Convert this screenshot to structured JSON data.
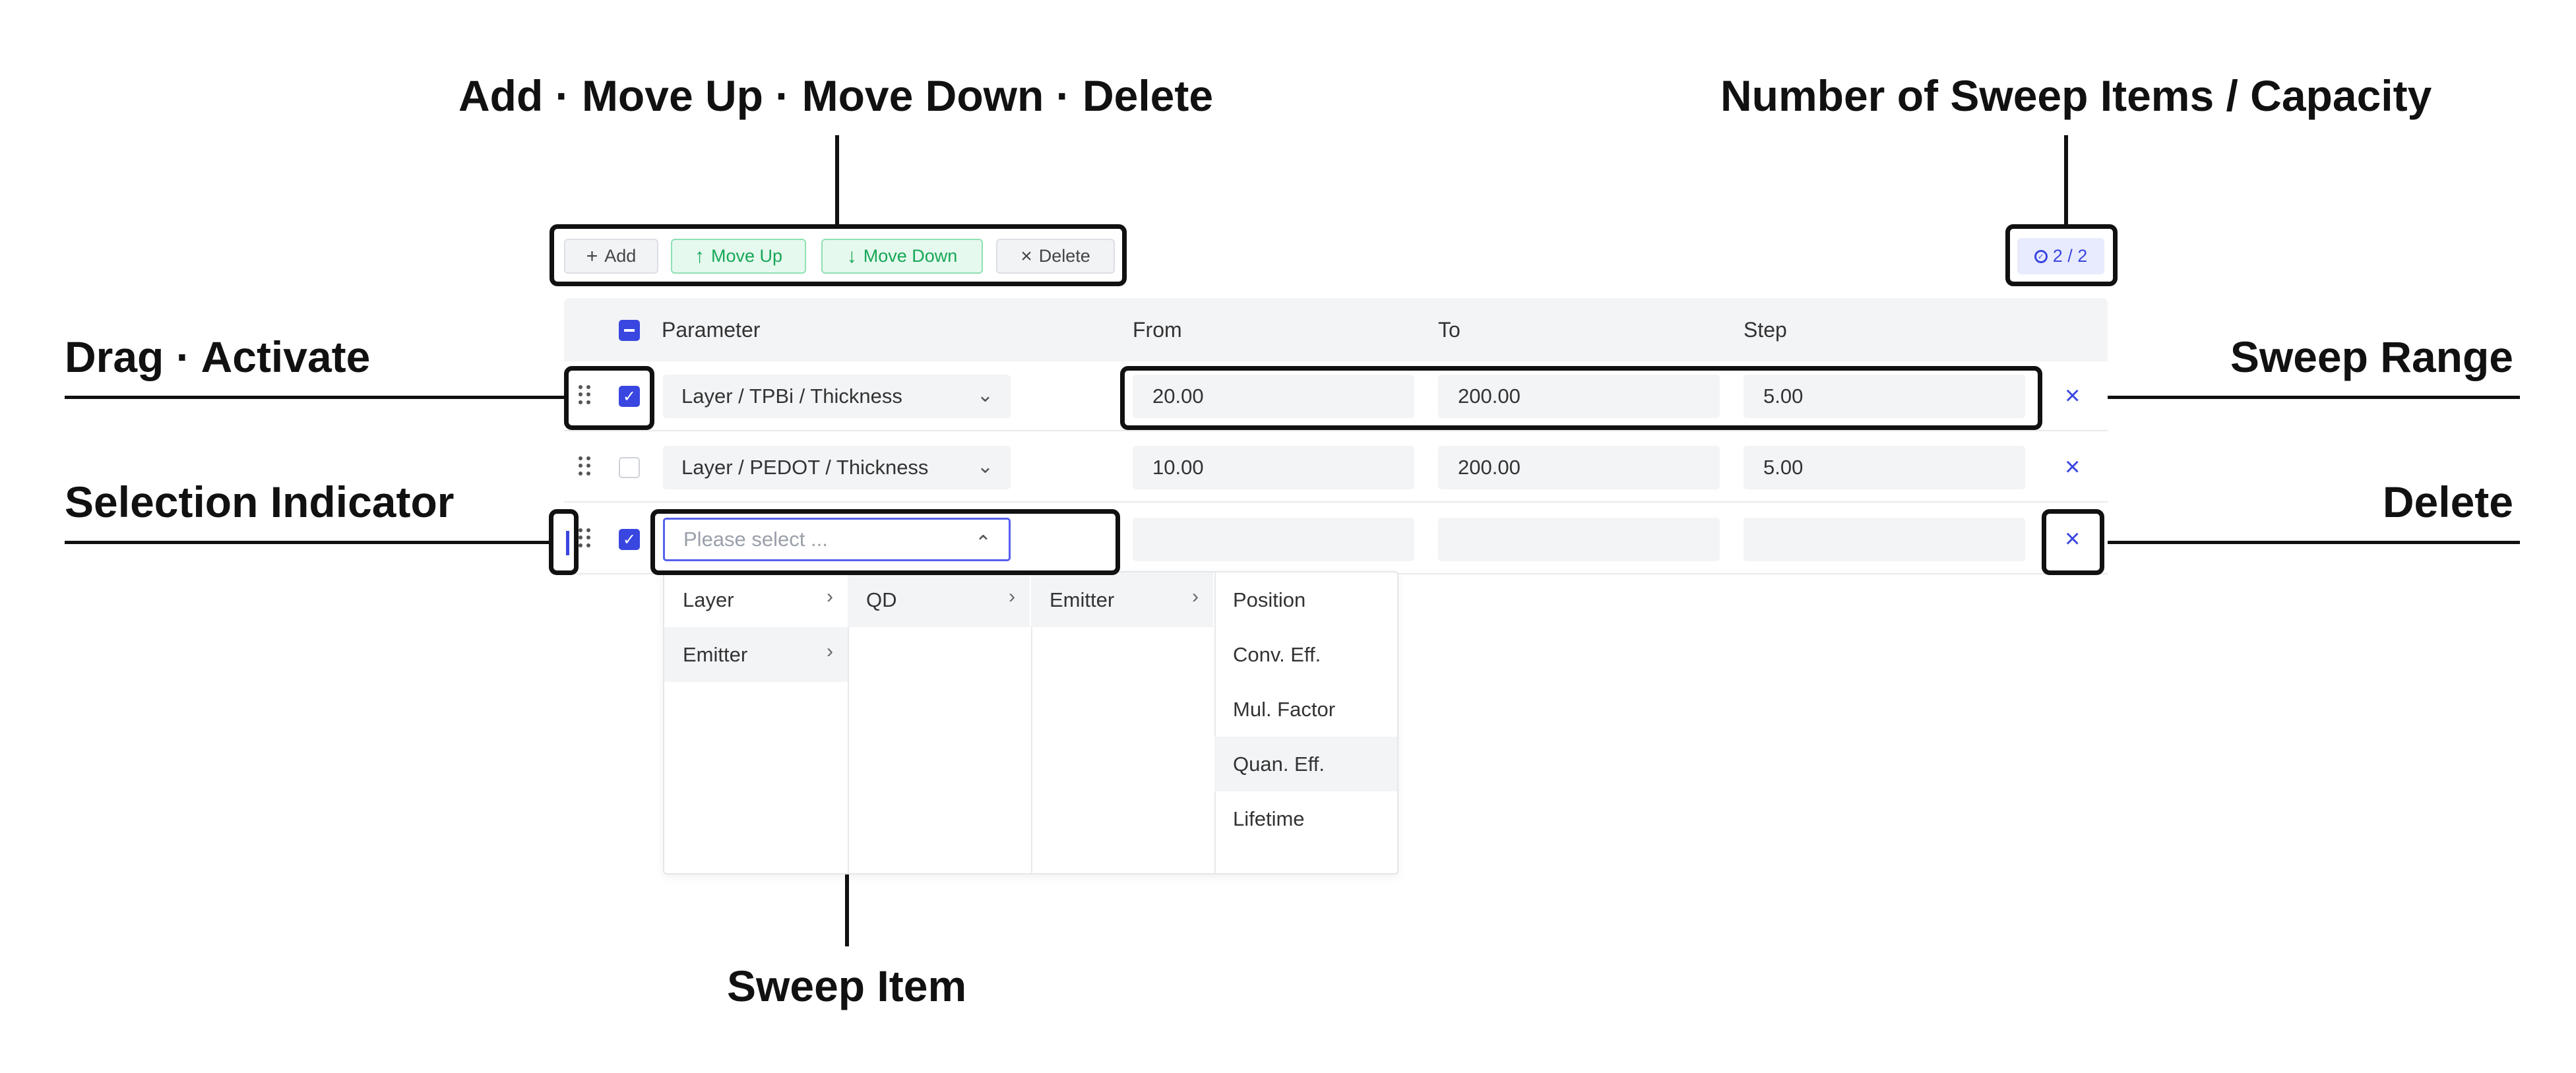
{
  "callouts": {
    "toolbar": "Add · Move Up · Move Down · Delete",
    "capacity": "Number of Sweep Items / Capacity",
    "drag": "Drag · Activate",
    "range": "Sweep Range",
    "selection": "Selection Indicator",
    "delete": "Delete",
    "item": "Sweep Item"
  },
  "toolbar": {
    "add": "Add",
    "move_up": "Move Up",
    "move_down": "Move Down",
    "delete": "Delete"
  },
  "counter": {
    "text": "2 / 2"
  },
  "table": {
    "headers": [
      "Parameter",
      "From",
      "To",
      "Step"
    ],
    "rows": [
      {
        "param": "Layer / TPBi / Thickness",
        "from": "20.00",
        "to": "200.00",
        "step": "5.00",
        "checked": true
      },
      {
        "param": "Layer / PEDOT / Thickness",
        "from": "10.00",
        "to": "200.00",
        "step": "5.00",
        "checked": false
      },
      {
        "param": "",
        "placeholder": "Please select ...",
        "from": "",
        "to": "",
        "step": "",
        "checked": true
      }
    ]
  },
  "cascader": {
    "col1": [
      "Layer",
      "Emitter"
    ],
    "col2": [
      "QD"
    ],
    "col3": [
      "Emitter"
    ],
    "col4": [
      "Position",
      "Conv. Eff.",
      "Mul. Factor",
      "Quan. Eff.",
      "Lifetime"
    ]
  },
  "colors": {
    "accent": "#3a46e0",
    "green": "#15a756",
    "header_bg": "#f3f4f6"
  }
}
